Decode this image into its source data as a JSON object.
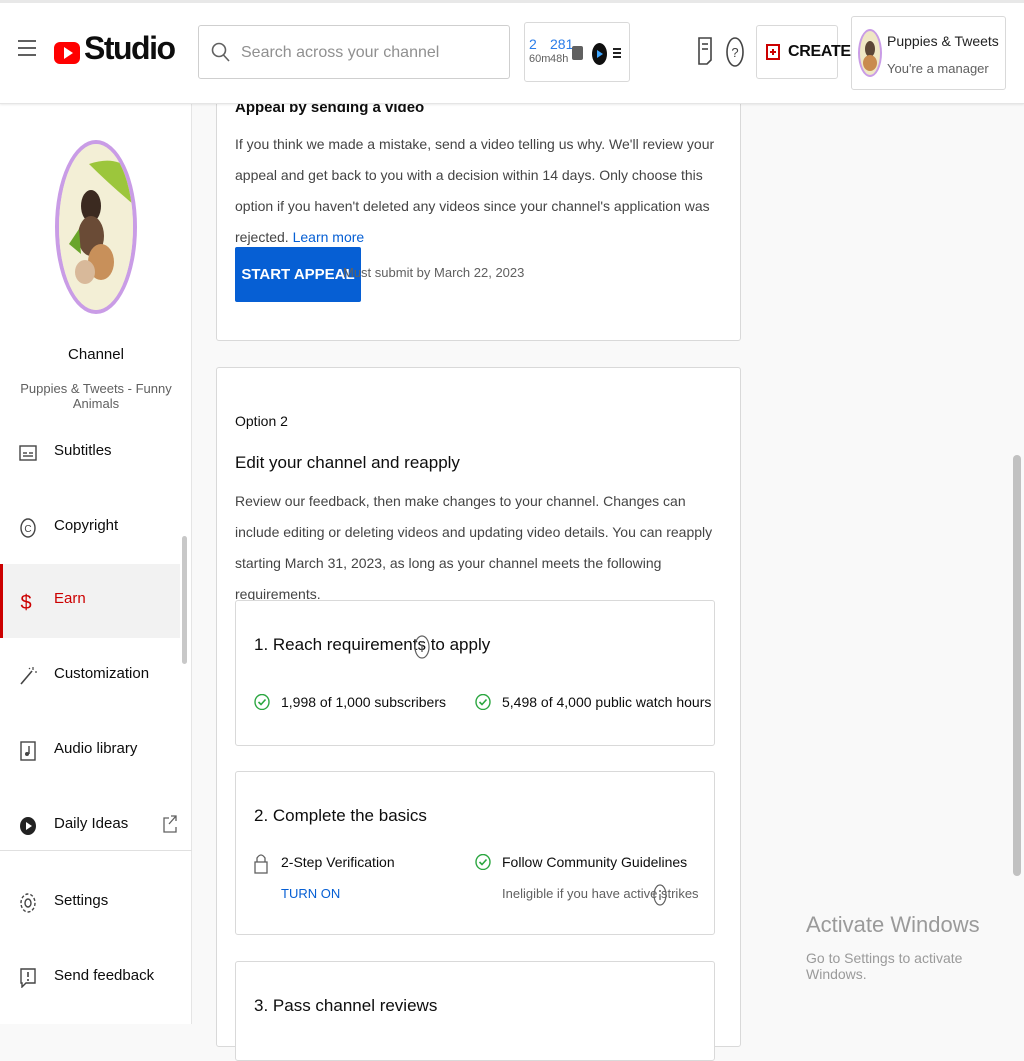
{
  "header": {
    "logo_text": "Studio",
    "search_placeholder": "Search across your channel",
    "stats": [
      {
        "value": "2",
        "unit": "60m"
      },
      {
        "value": "281",
        "unit": "48h"
      }
    ],
    "create_label": "CREATE",
    "account": {
      "name": "Puppies & Tweets - Fun...",
      "role": "You're a manager"
    }
  },
  "sidebar": {
    "channel_title": "Channel",
    "channel_name": "Puppies & Tweets - Funny Animals",
    "items": [
      {
        "label": "Subtitles",
        "icon": "subtitles-icon"
      },
      {
        "label": "Copyright",
        "icon": "copyright-icon"
      },
      {
        "label": "Earn",
        "icon": "dollar-icon",
        "active": true
      },
      {
        "label": "Customization",
        "icon": "magic-wand-icon"
      },
      {
        "label": "Audio library",
        "icon": "audio-library-icon"
      },
      {
        "label": "Daily Ideas",
        "icon": "play-circle-icon",
        "external": true
      },
      {
        "label": "Settings",
        "icon": "gear-icon"
      },
      {
        "label": "Send feedback",
        "icon": "feedback-icon"
      }
    ]
  },
  "option1": {
    "heading": "Appeal by sending a video",
    "text": "If you think we made a mistake, send a video telling us why. We'll review your appeal and get back to you with a decision within 14 days. Only choose this option if you haven't deleted any videos since your channel's application was rejected.",
    "learn_more": "Learn more",
    "button": "START APPEAL",
    "deadline": "Must submit by March 22, 2023"
  },
  "option2": {
    "label": "Option 2",
    "title": "Edit your channel and reapply",
    "text": "Review our feedback, then make changes to your channel. Changes can include editing or deleting videos and updating video details. You can reapply starting March 31, 2023, as long as your channel meets the following requirements.",
    "step1": {
      "title": "1. Reach requirements to apply",
      "subscribers": "1,998 of 1,000 subscribers",
      "watch_hours": "5,498 of 4,000 public watch hours"
    },
    "step2": {
      "title": "2. Complete the basics",
      "verification": "2-Step Verification",
      "turn_on": "TURN ON",
      "guidelines": "Follow Community Guidelines",
      "guidelines_note": "Ineligible if you have active strikes"
    },
    "step3": {
      "title": "3. Pass channel reviews"
    }
  },
  "watermark": {
    "line1": "Activate Windows",
    "line2": "Go to Settings to activate Windows."
  },
  "colors": {
    "accent": "#065fd4",
    "brand": "#ff0000",
    "active": "#cc0000",
    "check": "#2ba640"
  }
}
